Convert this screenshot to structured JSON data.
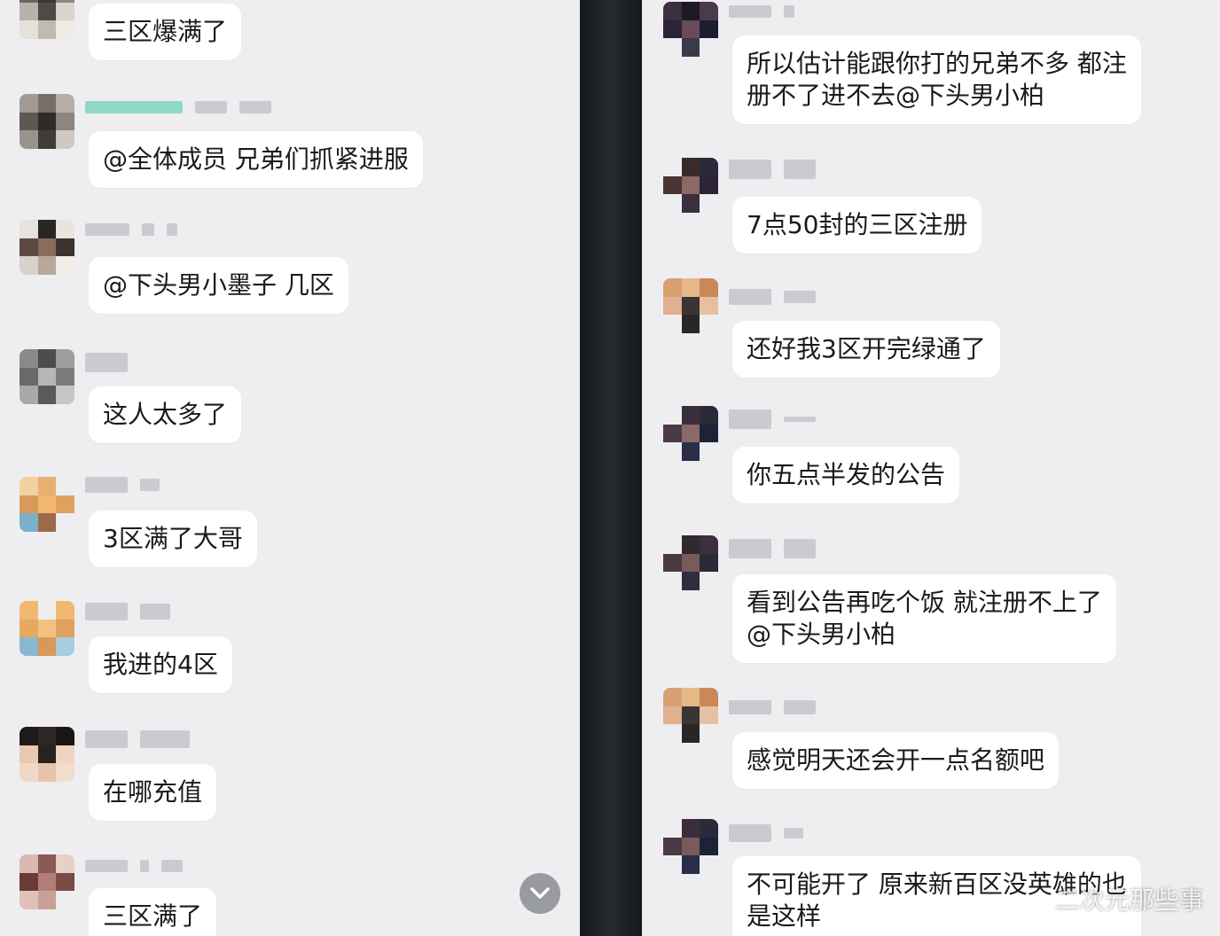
{
  "left_chat": {
    "messages": [
      {
        "text": "三区爆满了"
      },
      {
        "text": "@全体成员 兄弟们抓紧进服"
      },
      {
        "text": "@下头男小墨子 几区"
      },
      {
        "text": "这人太多了"
      },
      {
        "text": "3区满了大哥"
      },
      {
        "text": "我进的4区"
      },
      {
        "text": "在哪充值"
      },
      {
        "text": "三区满了"
      }
    ]
  },
  "right_chat": {
    "messages": [
      {
        "text": "所以估计能跟你打的兄弟不多 都注\n册不了进不去@下头男小柏"
      },
      {
        "text": "7点50封的三区注册"
      },
      {
        "text": "还好我3区开完绿通了"
      },
      {
        "text": "你五点半发的公告"
      },
      {
        "text": "看到公告再吃个饭 就注册不上了\n@下头男小柏"
      },
      {
        "text": "感觉明天还会开一点名额吧"
      },
      {
        "text": "不可能开了 原来新百区没英雄的也\n是这样"
      }
    ]
  },
  "watermark": {
    "text": "二次元那些事"
  },
  "colors": {
    "chat_background": "#eeeef0",
    "bubble": "#ffffff",
    "divider": "#1b1e22"
  },
  "icons": {
    "scroll_button": "chevron-down-icon"
  }
}
